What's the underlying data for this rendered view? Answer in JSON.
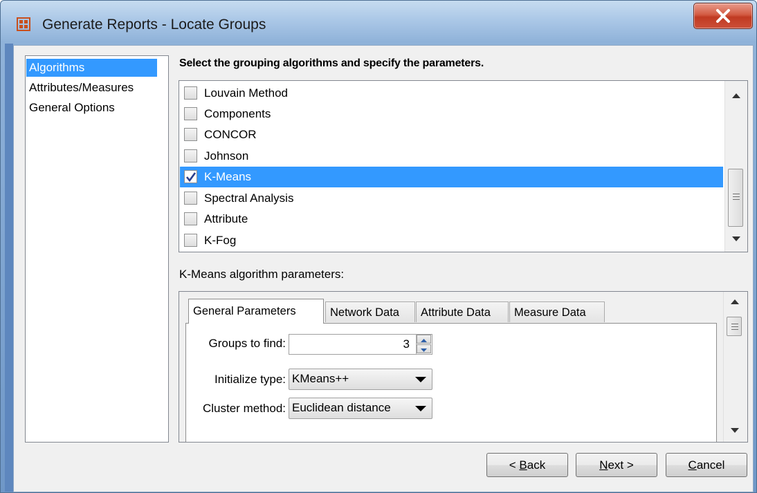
{
  "window": {
    "title": "Generate Reports - Locate Groups",
    "close_label": "X"
  },
  "nav": {
    "items": [
      {
        "label": "Algorithms",
        "selected": true
      },
      {
        "label": "Attributes/Measures",
        "selected": false
      },
      {
        "label": "General Options",
        "selected": false
      }
    ]
  },
  "algorithms": {
    "heading": "Select the grouping algorithms and specify the parameters.",
    "items": [
      {
        "label": "Louvain Method",
        "checked": false
      },
      {
        "label": "Components",
        "checked": false
      },
      {
        "label": "CONCOR",
        "checked": false
      },
      {
        "label": "Johnson",
        "checked": false
      },
      {
        "label": "K-Means",
        "checked": true
      },
      {
        "label": "Spectral Analysis",
        "checked": false
      },
      {
        "label": "Attribute",
        "checked": false
      },
      {
        "label": "K-Fog",
        "checked": false
      }
    ]
  },
  "params": {
    "label": "K-Means algorithm parameters:",
    "tabs": [
      {
        "label": "General Parameters",
        "active": true
      },
      {
        "label": "Network Data",
        "active": false
      },
      {
        "label": "Attribute Data",
        "active": false
      },
      {
        "label": "Measure Data",
        "active": false
      }
    ],
    "groups_label": "Groups to find:",
    "groups_value": "3",
    "init_label": "Initialize type:",
    "init_value": "KMeans++",
    "cluster_label": "Cluster method:",
    "cluster_value": "Euclidean distance"
  },
  "buttons": {
    "back_prefix": "< ",
    "back_mnemonic": "B",
    "back_rest": "ack",
    "next_mnemonic": "N",
    "next_rest": "ext >",
    "cancel_mnemonic": "C",
    "cancel_rest": "ancel"
  },
  "colors": {
    "selection": "#3399ff",
    "close_button": "#c03a22"
  }
}
